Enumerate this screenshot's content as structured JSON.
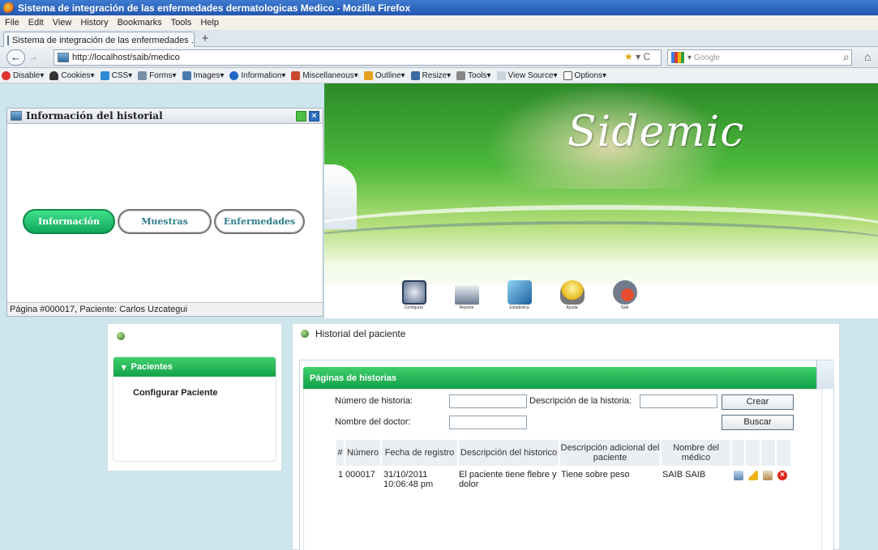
{
  "window": {
    "title": "Sistema de integración de las enfermedades dermatologicas Medico - Mozilla Firefox"
  },
  "menu": [
    "File",
    "Edit",
    "View",
    "History",
    "Bookmarks",
    "Tools",
    "Help"
  ],
  "tab": {
    "label": "Sistema de integración de las enfermedades ...",
    "new_tab": "+"
  },
  "nav": {
    "back": "←",
    "forward": "→",
    "url": "http://localhost/saib/medico",
    "search_placeholder": "Google",
    "go": "⌕",
    "home": "⌂",
    "star": "★",
    "reload": "C"
  },
  "devbar": [
    "Disable",
    "Cookies",
    "CSS",
    "Forms",
    "Images",
    "Information",
    "Miscellaneous",
    "Outline",
    "Resize",
    "Tools",
    "View Source",
    "Options"
  ],
  "header": {
    "logo": "Sidemic"
  },
  "app_icons": [
    "Configurar",
    "Reporte",
    "Estadistica",
    "Ayuda",
    "Salir"
  ],
  "info_panel": {
    "title": "Información del historial",
    "close": "×",
    "tabs": [
      "Información",
      "Muestras",
      "Enfermedades"
    ],
    "footer": "Página #000017, Paciente: Carlos Uzcategui"
  },
  "left_menu": {
    "section": "Pacientes",
    "chevron": "▾",
    "items": [
      "Configurar Paciente"
    ]
  },
  "main": {
    "title": "Historial del paciente",
    "section": "Páginas de historias",
    "form": {
      "numero_label": "Número de historia:",
      "numero_value": "",
      "descripcion_label": "Descripción de la historia:",
      "descripcion_value": "",
      "doctor_label": "Nombre del doctor:",
      "doctor_value": "",
      "crear": "Crear",
      "buscar": "Buscar"
    },
    "table": {
      "headers": [
        "#",
        "Número",
        "Fecha de registro",
        "Descripción del historico",
        "Descripción adicional del paciente",
        "Nombre del médico"
      ],
      "rows": [
        {
          "n": "1",
          "numero": "000017",
          "fecha": "31/10/2011 10:06:48 pm",
          "descripcion": "El paciente tiene flebre y dolor",
          "adicional": "Tiene sobre peso",
          "medico": "SAIB SAIB"
        }
      ]
    }
  }
}
